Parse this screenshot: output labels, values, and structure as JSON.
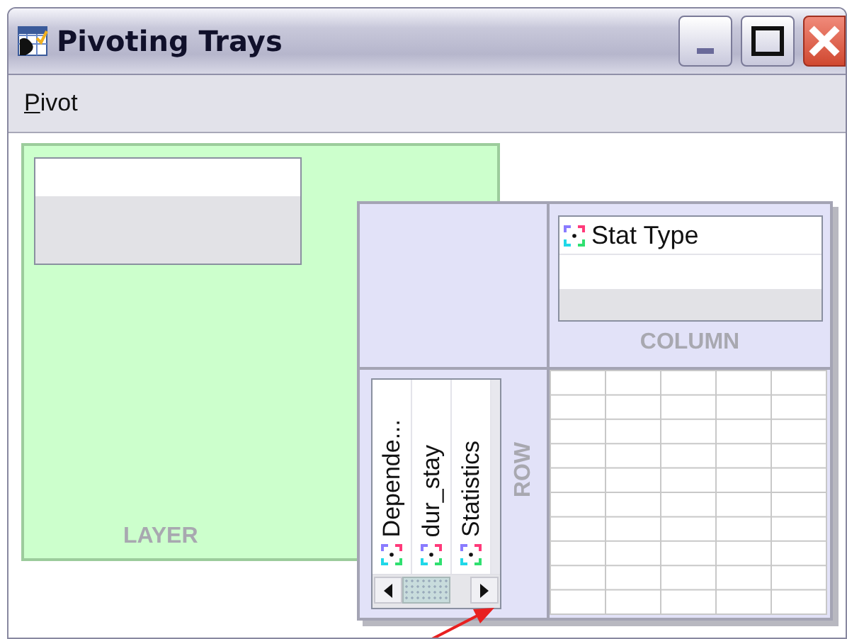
{
  "window": {
    "title": "Pivoting Trays"
  },
  "menu": [
    {
      "label": "Pivot"
    }
  ],
  "layer": {
    "label": "LAYER"
  },
  "column": {
    "label": "COLUMN",
    "items": [
      {
        "label": "Stat Type"
      }
    ]
  },
  "row": {
    "label": "ROW",
    "items": [
      {
        "label": "Depende..."
      },
      {
        "label": "dur_stay"
      },
      {
        "label": "Statistics"
      }
    ]
  }
}
